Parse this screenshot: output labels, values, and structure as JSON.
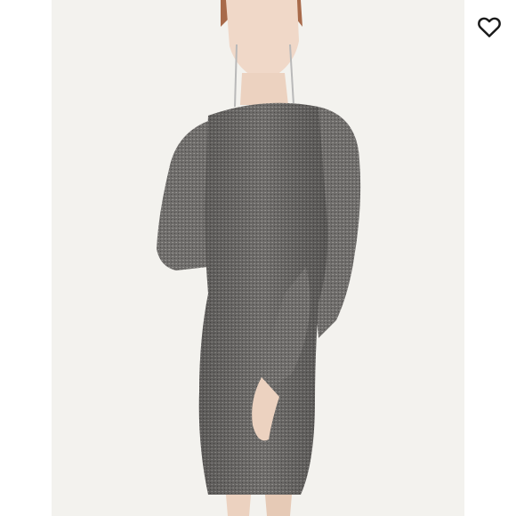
{
  "listing": {
    "image_subject": "metallic-knit-dress",
    "like_icon": "heart-outline-icon",
    "colors": {
      "photo_background": "#f3f2ee",
      "dress": "#6e6c6a",
      "icon": "#1a1a1a"
    }
  }
}
